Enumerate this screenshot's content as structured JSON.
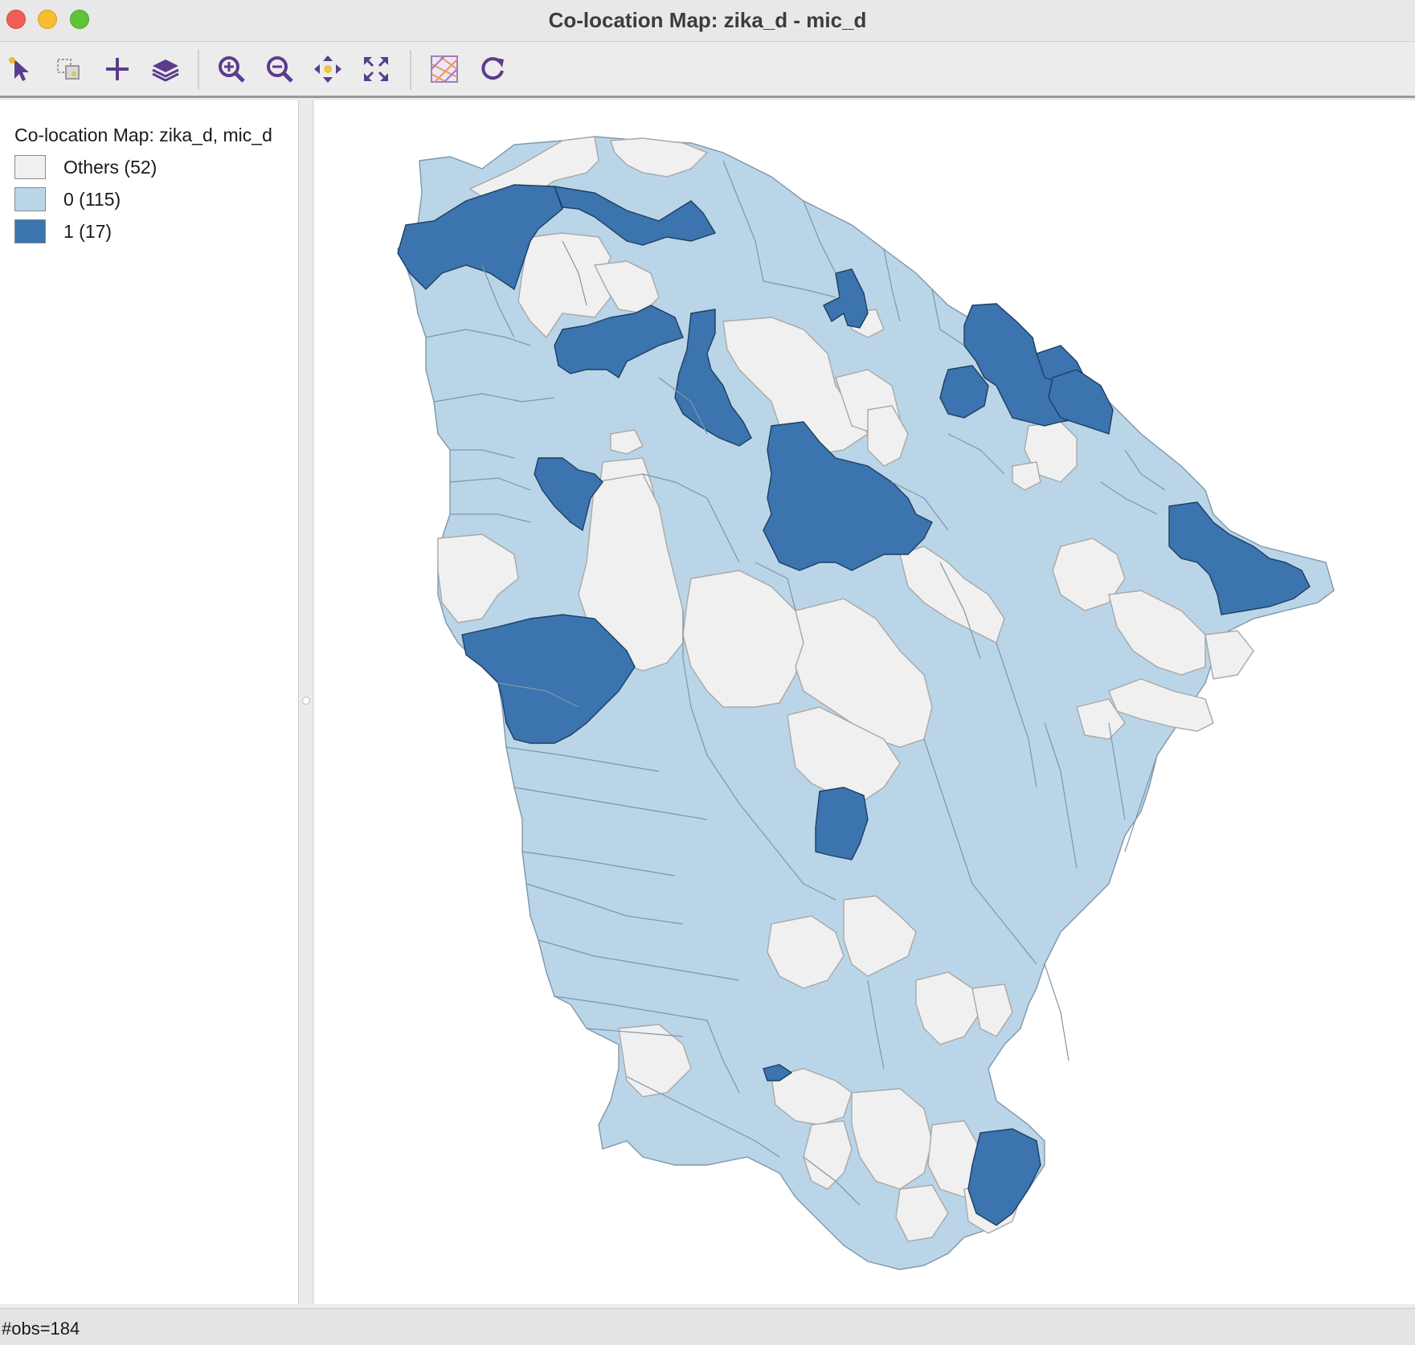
{
  "window": {
    "title": "Co-location Map: zika_d - mic_d"
  },
  "toolbar": {
    "tools": [
      {
        "icon": "select-pointer-icon"
      },
      {
        "icon": "selection-shape-icon"
      },
      {
        "icon": "add-layer-icon"
      },
      {
        "icon": "layers-icon"
      },
      {
        "icon": "zoom-in-icon"
      },
      {
        "icon": "zoom-out-icon"
      },
      {
        "icon": "pan-icon"
      },
      {
        "icon": "full-extent-icon"
      },
      {
        "icon": "map-basemap-icon"
      },
      {
        "icon": "refresh-icon"
      }
    ]
  },
  "legend": {
    "title": "Co-location Map: zika_d, mic_d",
    "categories": [
      {
        "label": "Others (52)",
        "color": "#f0f0f0"
      },
      {
        "label": "0 (115)",
        "color": "#bad5e7"
      },
      {
        "label": "1 (17)",
        "color": "#3b74ae"
      }
    ]
  },
  "status": {
    "text": "#obs=184"
  }
}
